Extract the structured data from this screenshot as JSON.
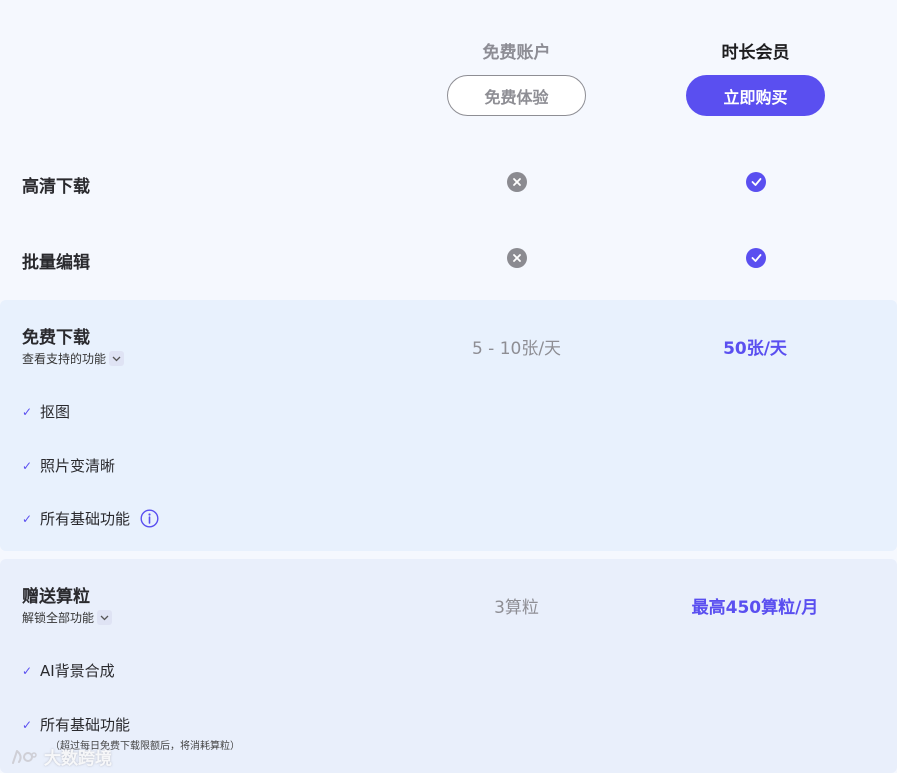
{
  "header": {
    "free_title": "免费账户",
    "vip_title": "时长会员",
    "free_button": "免费体验",
    "vip_button": "立即购买"
  },
  "features": [
    {
      "label": "高清下载",
      "free": "x-icon",
      "vip": "check-icon"
    },
    {
      "label": "批量编辑",
      "free": "x-icon",
      "vip": "check-icon"
    }
  ],
  "panel_download": {
    "title": "免费下载",
    "subtitle": "查看支持的功能",
    "free_value": "5 - 10张/天",
    "vip_value": "50张/天",
    "items": [
      "抠图",
      "照片变清晰",
      "所有基础功能"
    ]
  },
  "panel_credits": {
    "title": "赠送算粒",
    "subtitle": "解锁全部功能",
    "free_value": "3算粒",
    "vip_value": "最高450算粒/月",
    "items": [
      "AI背景合成",
      "所有基础功能"
    ],
    "note": "（超过每日免费下载限额后，将消耗算粒）"
  },
  "watermark": "大数跨境",
  "colors": {
    "accent": "#5a4ff0",
    "muted": "#8e8e94",
    "panel_bg_1": "#e8f1fd",
    "panel_bg_2": "#e9effb"
  }
}
